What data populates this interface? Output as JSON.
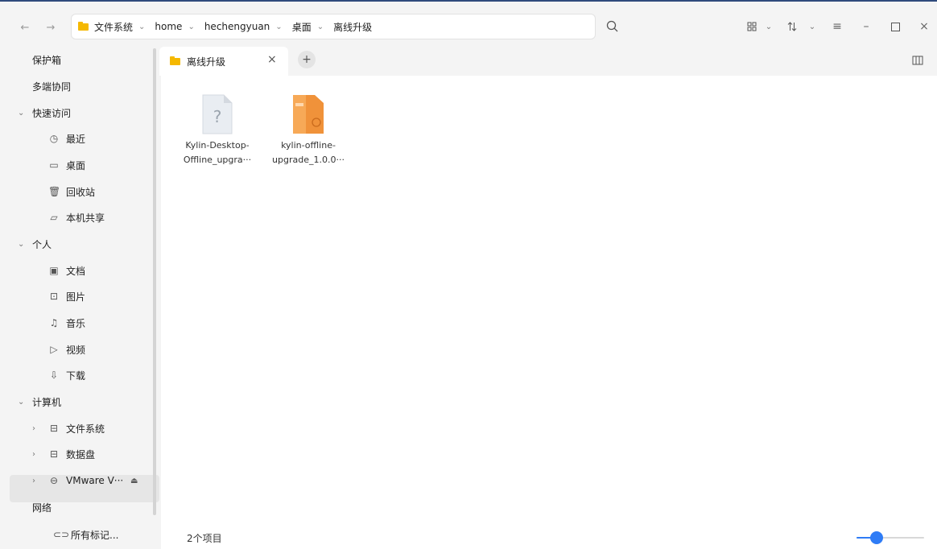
{
  "toolbar": {
    "back_icon": "back-arrow-icon",
    "forward_icon": "forward-arrow-icon",
    "breadcrumbs": [
      "文件系统",
      "home",
      "hechengyuan",
      "桌面",
      "离线升级"
    ],
    "view_icon": "grid-view-icon",
    "sort_icon": "sort-icon",
    "menu_icon": "hamburger-menu-icon"
  },
  "sidebar": {
    "items": [
      {
        "label": "保护箱"
      },
      {
        "label": "多端协同"
      },
      {
        "label": "快速访问",
        "expanded": true
      },
      {
        "label": "最近",
        "icon": "clock-icon"
      },
      {
        "label": "桌面",
        "icon": "desktop-icon"
      },
      {
        "label": "回收站",
        "icon": "trash-icon"
      },
      {
        "label": "本机共享",
        "icon": "folder-outline-icon"
      },
      {
        "label": "个人",
        "expanded": true
      },
      {
        "label": "文档",
        "icon": "document-icon"
      },
      {
        "label": "图片",
        "icon": "image-icon"
      },
      {
        "label": "音乐",
        "icon": "music-icon"
      },
      {
        "label": "视频",
        "icon": "video-icon"
      },
      {
        "label": "下载",
        "icon": "download-icon"
      },
      {
        "label": "计算机",
        "expanded": true
      },
      {
        "label": "文件系统",
        "icon": "drive-icon"
      },
      {
        "label": "数据盘",
        "icon": "drive-icon"
      },
      {
        "label": "VMware V···",
        "icon": "disc-icon"
      },
      {
        "label": "网络"
      },
      {
        "label": "所有标记...",
        "icon": "tag-icon"
      }
    ]
  },
  "tab": {
    "title": "离线升级"
  },
  "files": [
    {
      "name_line1": "Kylin-Desktop-",
      "name_line2": "Offline_upgra···",
      "icon": "unknown-file-icon"
    },
    {
      "name_line1": "kylin-offline-",
      "name_line2": "upgrade_1.0.0···",
      "icon": "deb-package-icon"
    }
  ],
  "status": {
    "count": "2个项目",
    "zoom_fraction": 0.3
  },
  "colors": {
    "accent": "#2f7cf6",
    "folder": "#f5b800",
    "package": "#f0923a"
  }
}
